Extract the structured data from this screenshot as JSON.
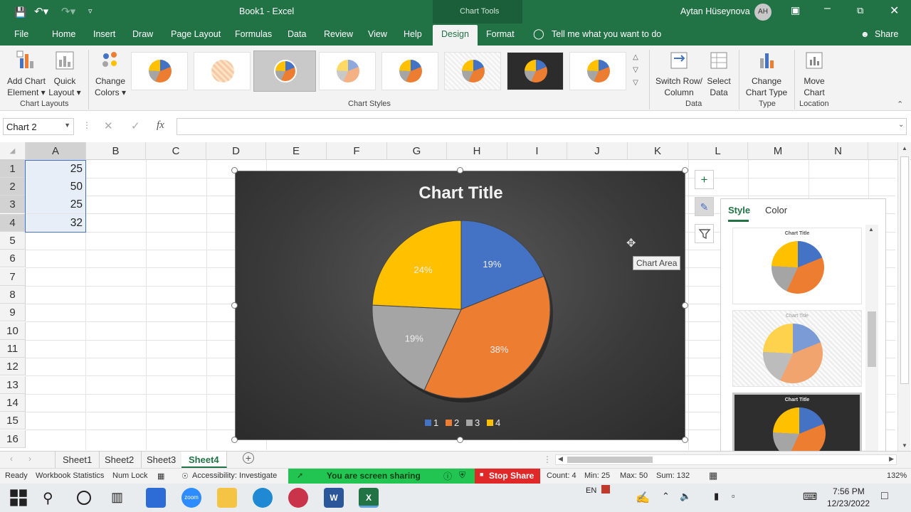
{
  "window": {
    "title": "Book1  -  Excel",
    "context_group": "Chart Tools",
    "user_name": "Aytan Hüseynova",
    "user_initials": "AH"
  },
  "tabs": [
    "File",
    "Home",
    "Insert",
    "Draw",
    "Page Layout",
    "Formulas",
    "Data",
    "Review",
    "View",
    "Help",
    "Design",
    "Format"
  ],
  "active_tab": "Design",
  "tell_me": "Tell me what you want to do",
  "share_label": "Share",
  "ribbon": {
    "add_chart_element": [
      "Add Chart",
      "Element"
    ],
    "quick_layout": [
      "Quick",
      "Layout"
    ],
    "change_colors": [
      "Change",
      "Colors"
    ],
    "switch_row_column": [
      "Switch Row/",
      "Column"
    ],
    "select_data": [
      "Select",
      "Data"
    ],
    "change_chart_type": [
      "Change",
      "Chart Type"
    ],
    "move_chart": [
      "Move",
      "Chart"
    ],
    "groups": {
      "chart_layouts": "Chart Layouts",
      "chart_styles": "Chart Styles",
      "data": "Data",
      "type": "Type",
      "location": "Location"
    }
  },
  "formula_bar": {
    "name_box": "Chart 2",
    "fx": "fx",
    "value": ""
  },
  "columns": [
    "A",
    "B",
    "C",
    "D",
    "E",
    "F",
    "G",
    "H",
    "I",
    "J",
    "K",
    "L",
    "M",
    "N"
  ],
  "rows": [
    "1",
    "2",
    "3",
    "4",
    "5",
    "6",
    "7",
    "8",
    "9",
    "10",
    "11",
    "12",
    "13",
    "14",
    "15",
    "16"
  ],
  "cells": {
    "A1": "25",
    "A2": "50",
    "A3": "25",
    "A4": "32"
  },
  "chart_data": {
    "type": "pie",
    "title": "Chart Title",
    "categories": [
      "1",
      "2",
      "3",
      "4"
    ],
    "values": [
      25,
      50,
      25,
      32
    ],
    "labels": [
      "19%",
      "38%",
      "19%",
      "24%"
    ],
    "colors": [
      "#4472c4",
      "#ed7d31",
      "#a5a5a5",
      "#ffc000"
    ],
    "legend": "bottom"
  },
  "tooltip": "Chart Area",
  "style_pane": {
    "tabs": [
      "Style",
      "Color"
    ],
    "active": "Style",
    "thumb_titles": [
      "Chart Title",
      "Chart Title",
      "Chart Title"
    ]
  },
  "sheet_tabs": [
    "Sheet1",
    "Sheet2",
    "Sheet3",
    "Sheet4"
  ],
  "active_sheet": "Sheet4",
  "status": {
    "ready": "Ready",
    "workbook_stats": "Workbook Statistics",
    "num_lock": "Num Lock",
    "accessibility": "Accessibility: Investigate",
    "sharing": "You are screen sharing",
    "stop_share": "Stop Share",
    "count": "Count: 4",
    "min": "Min: 25",
    "max": "Max: 50",
    "sum": "Sum: 132",
    "zoom": "132%"
  },
  "taskbar": {
    "lang": "EN",
    "time": "7:56 PM",
    "date": "12/23/2022"
  }
}
